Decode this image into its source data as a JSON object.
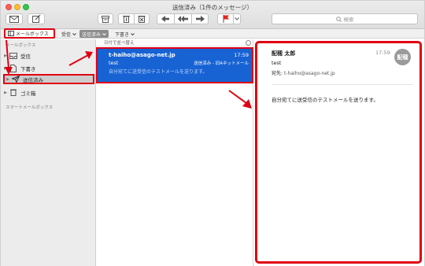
{
  "window": {
    "title": "送信済み（1件のメッセージ）"
  },
  "toolbar": {
    "icons": [
      "envelope-icon",
      "compose-icon",
      "archive-icon",
      "trash-icon",
      "junk-icon",
      "reply-icon",
      "reply-all-icon",
      "forward-icon",
      "flag-icon",
      "flag-menu-icon"
    ],
    "search_placeholder": "検索"
  },
  "favorites": {
    "mailbox_label": "メールボックス",
    "inbox_label": "受信",
    "sent_label": "送信済み",
    "drafts_label": "下書き"
  },
  "sidebar": {
    "header": "メールボックス",
    "items": [
      {
        "label": "受信",
        "icon": "inbox-icon"
      },
      {
        "label": "下書き",
        "icon": "document-icon"
      },
      {
        "label": "送信済み",
        "icon": "paper-plane-icon",
        "selected": true
      },
      {
        "label": "ゴミ箱",
        "icon": "trash-icon"
      }
    ],
    "smart_header": "スマートメールボックス"
  },
  "message_list": {
    "sort_label": "日付で並べ替え",
    "messages": [
      {
        "from": "t-haiho@asago-net.jp",
        "time": "17:59",
        "subject": "test",
        "mailbox": "送信済み - 旧Aネットメール",
        "preview": "自分宛てに送受信のテストメールを送ります。"
      }
    ]
  },
  "reading_pane": {
    "sender": "配穂 太郎",
    "time": "17:59",
    "avatar_text": "配穂",
    "subject": "test",
    "to_label": "宛先:",
    "to": "t-haiho@asago-net.jp",
    "body": "自分宛てに送受信のテストメールを送ります。"
  },
  "colors": {
    "highlight": "#e00012",
    "selection": "#1763d4",
    "sidebar_bg": "#ececec"
  }
}
